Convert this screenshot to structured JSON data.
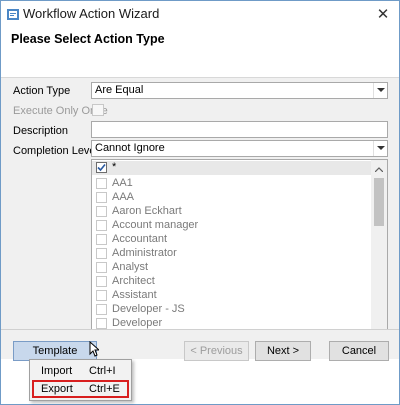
{
  "window": {
    "title": "Workflow Action Wizard",
    "close_glyph": "✕",
    "app_icon": "workflow-icon"
  },
  "header": {
    "title": "Please Select Action Type"
  },
  "form": {
    "action_type_label": "Action Type",
    "action_type_value": "Are Equal",
    "execute_once_label": "Execute Only Once",
    "execute_once_checked": false,
    "description_label": "Description",
    "description_value": "",
    "completion_label": "Completion Level",
    "completion_value": "Cannot Ignore"
  },
  "list": {
    "items": [
      {
        "label": "*",
        "checked": true
      },
      {
        "label": "AA1",
        "checked": false
      },
      {
        "label": "AAA",
        "checked": false
      },
      {
        "label": "Aaron Eckhart",
        "checked": false
      },
      {
        "label": "Account manager",
        "checked": false
      },
      {
        "label": "Accountant",
        "checked": false
      },
      {
        "label": "Administrator",
        "checked": false
      },
      {
        "label": "Analyst",
        "checked": false
      },
      {
        "label": "Architect",
        "checked": false
      },
      {
        "label": "Assistant",
        "checked": false
      },
      {
        "label": "Developer - JS",
        "checked": false
      },
      {
        "label": "Developer",
        "checked": false
      }
    ]
  },
  "footer": {
    "template_label": "Template",
    "previous_label": "< Previous",
    "next_label": "Next >",
    "cancel_label": "Cancel"
  },
  "menu": {
    "import_label": "Import",
    "import_shortcut": "Ctrl+I",
    "export_label": "Export",
    "export_shortcut": "Ctrl+E",
    "highlight_color": "#d81e1e"
  }
}
